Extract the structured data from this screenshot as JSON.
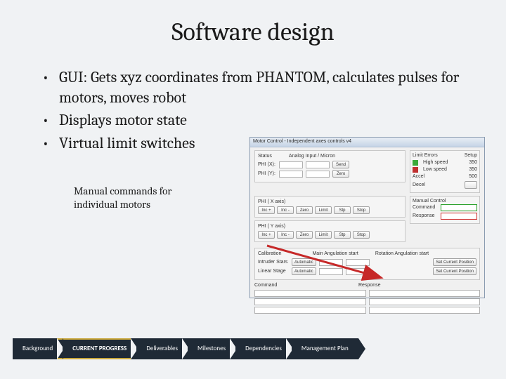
{
  "title": "Software design",
  "bullets": [
    "GUI: Gets xyz coordinates from PHANTOM, calculates pulses for motors, moves robot",
    "Displays motor state",
    "Virtual limit switches"
  ],
  "caption": "Manual commands for individual motors",
  "mock": {
    "titlebar": "Motor Control - Independent axes controls v4",
    "status_label": "Status",
    "analog_label": "Analog Input / Micron",
    "phi_x": "PHI (X):",
    "phi_y": "PHI (Y):",
    "send": "Send",
    "zero": "Zero",
    "limit_title": "Limit Errors",
    "limit_setup": "Setup",
    "high_speed": "High speed",
    "high_val": "350",
    "low_speed": "Low speed",
    "low_val": "350",
    "accel": "Accel",
    "accel_val": "500",
    "decel": "Decel",
    "phi_x_axis": "PHI ( X axis)",
    "phi_y_axis": "PHI ( Y axis)",
    "btn_inc": "Inc +",
    "btn_dec": "Inc -",
    "btn_zero": "Zero",
    "btn_limit": "Limit",
    "btn_stp": "Stp",
    "btn_stop": "Stop",
    "manual_title": "Manual Control",
    "command": "Command",
    "response": "Response",
    "calib": "Calibration",
    "main_angle": "Main Angulation start",
    "rot_angle": "Rotation Angulation start",
    "intruder": "Intruder Stars",
    "linear": "Linear Stage",
    "auto": "Automatic",
    "set_pos": "Set Current Position",
    "cmd2": "Command",
    "resp2": "Response"
  },
  "nav": {
    "items": [
      {
        "label": "Background",
        "highlight": false
      },
      {
        "label": "CURRENT PROGRESS",
        "highlight": true
      },
      {
        "label": "Deliverables",
        "highlight": false
      },
      {
        "label": "Milestones",
        "highlight": false
      },
      {
        "label": "Dependencies",
        "highlight": false
      },
      {
        "label": "Management Plan",
        "highlight": false
      }
    ]
  }
}
